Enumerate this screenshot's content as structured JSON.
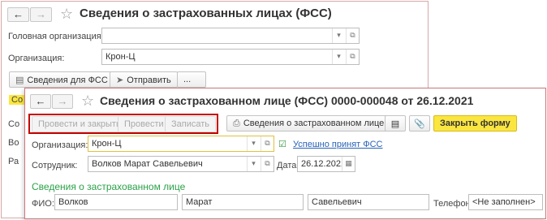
{
  "back_window": {
    "title": "Сведения о застрахованных лицах (ФСС)",
    "head_org_label": "Головная организация:",
    "head_org_value": "",
    "org_label": "Организация:",
    "org_value": "Крон-Ц",
    "btn_info_fss": "Сведения для ФСС",
    "btn_send": "Отправить",
    "btn_more": "...",
    "tab_stub": "Со",
    "list_stub_1": "Со",
    "list_stub_2": "Во",
    "list_stub_3": "Ра"
  },
  "front_window": {
    "title": "Сведения о застрахованном лице (ФСС) 0000-000048 от 26.12.2021",
    "toolbar": {
      "post_close": "Провести и закрыть",
      "post": "Провести",
      "save": "Записать",
      "print_info": "Сведения о застрахованном лице",
      "close_form": "Закрыть форму"
    },
    "org_label": "Организация:",
    "org_value": "Крон-Ц",
    "status_link": "Успешно принят ФСС",
    "employee_label": "Сотрудник:",
    "employee_value": "Волков Марат Савельевич",
    "date_label": "Дата:",
    "date_value": "26.12.2021",
    "section_title": "Сведения о застрахованном лице",
    "fio_label": "ФИО:",
    "last_name": "Волков",
    "first_name": "Марат",
    "patronymic": "Савельевич",
    "phone_label": "Телефон:",
    "phone_value": "<Не заполнен>"
  },
  "colors": {
    "accent_yellow": "#fbe640",
    "highlight_red": "#c40000",
    "section_green": "#2aa148",
    "link_blue": "#2a63b8"
  },
  "icons": [
    "arrow-left-icon",
    "arrow-right-icon",
    "star-icon",
    "dropdown-icon",
    "open-icon",
    "print-icon",
    "send-icon",
    "list-icon",
    "clip-icon",
    "calendar-icon",
    "status-icon"
  ]
}
